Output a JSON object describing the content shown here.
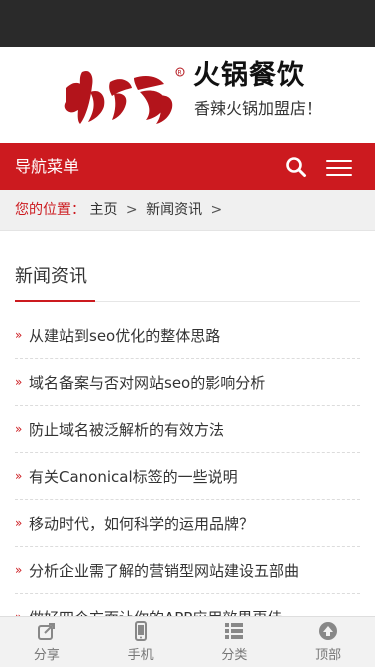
{
  "brand": {
    "logo_text": "火锅",
    "name": "火锅餐饮",
    "slogan": "香辣火锅加盟店！"
  },
  "navbar": {
    "title": "导航菜单",
    "search_icon": "search-icon",
    "menu_icon": "hamburger-menu-icon"
  },
  "breadcrumb": {
    "label": "您的位置：",
    "items": [
      "主页",
      "新闻资讯"
    ],
    "separator": ">"
  },
  "section": {
    "title": "新闻资讯"
  },
  "news": [
    {
      "title": "从建站到seo优化的整体思路"
    },
    {
      "title": "域名备案与否对网站seo的影响分析"
    },
    {
      "title": "防止域名被泛解析的有效方法"
    },
    {
      "title": "有关Canonical标签的一些说明"
    },
    {
      "title": "移动时代，如何科学的运用品牌？"
    },
    {
      "title": "分析企业需了解的营销型网站建设五部曲"
    },
    {
      "title": "做好四个方面让你的APP应用效果更佳"
    }
  ],
  "tabbar": [
    {
      "label": "分享",
      "icon": "share-icon"
    },
    {
      "label": "手机",
      "icon": "mobile-icon"
    },
    {
      "label": "分类",
      "icon": "category-icon"
    },
    {
      "label": "顶部",
      "icon": "back-to-top-icon"
    }
  ],
  "colors": {
    "accent": "#cc1a1f",
    "status_bar": "#2a2a2a",
    "breadcrumb_bg": "#f0f0f0",
    "tabbar_bg": "#f2f2f2"
  }
}
